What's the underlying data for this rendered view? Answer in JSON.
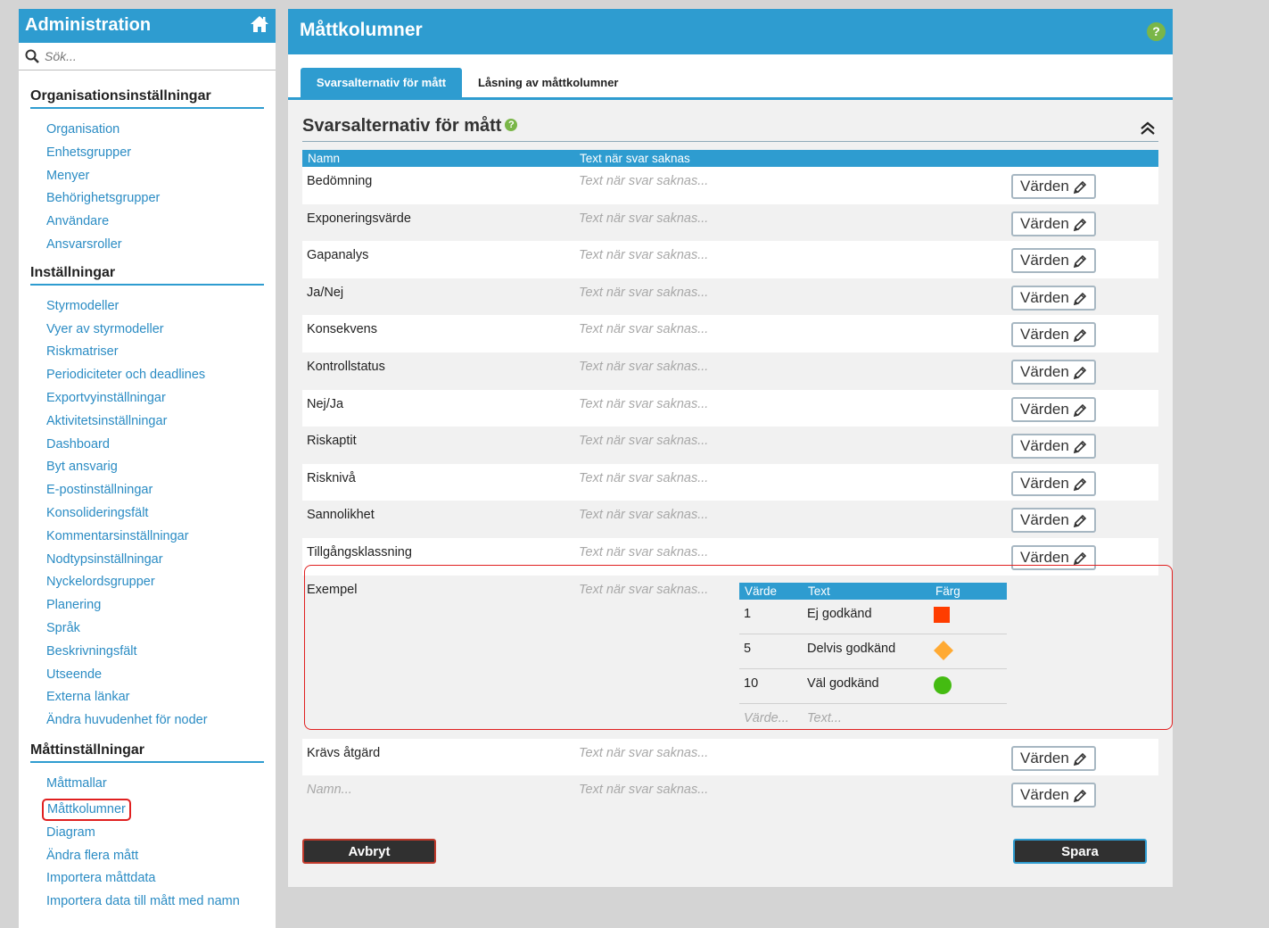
{
  "sidebar": {
    "title": "Administration",
    "search_placeholder": "Sök...",
    "sections": [
      {
        "heading": "Organisationsinställningar",
        "items": [
          "Organisation",
          "Enhetsgrupper",
          "Menyer",
          "Behörighetsgrupper",
          "Användare",
          "Ansvarsroller"
        ]
      },
      {
        "heading": "Inställningar",
        "items": [
          "Styrmodeller",
          "Vyer av styrmodeller",
          "Riskmatriser",
          "Periodiciteter och deadlines",
          "Exportvyinställningar",
          "Aktivitetsinställningar",
          "Dashboard",
          "Byt ansvarig",
          "E-postinställningar",
          "Konsolideringsfält",
          "Kommentarsinställningar",
          "Nodtypsinställningar",
          "Nyckelordsgrupper",
          "Planering",
          "Språk",
          "Beskrivningsfält",
          "Utseende",
          "Externa länkar",
          "Ändra huvudenhet för noder"
        ]
      },
      {
        "heading": "Måttinställningar",
        "items": [
          "Måttmallar",
          "Måttkolumner",
          "Diagram",
          "Ändra flera mått",
          "Importera måttdata",
          "Importera data till mått med namn"
        ]
      }
    ]
  },
  "main": {
    "title": "Måttkolumner",
    "help": "?",
    "tabs": [
      "Svarsalternativ för mått",
      "Låsning av måttkolumner"
    ],
    "section_title": "Svarsalternativ för mått",
    "columns": {
      "name": "Namn",
      "missing": "Text när svar saknas"
    },
    "missing_placeholder": "Text när svar saknas...",
    "varden_label": "Värden",
    "rows": [
      "Bedömning",
      "Exponeringsvärde",
      "Gapanalys",
      "Ja/Nej",
      "Konsekvens",
      "Kontrollstatus",
      "Nej/Ja",
      "Riskaptit",
      "Risknivå",
      "Sannolikhet",
      "Tillgångsklassning"
    ],
    "expanded": {
      "name": "Exempel",
      "columns": {
        "value": "Värde",
        "text": "Text",
        "color": "Färg"
      },
      "values": [
        {
          "value": "1",
          "text": "Ej godkänd",
          "shape": "square",
          "color": "#ff3d00"
        },
        {
          "value": "5",
          "text": "Delvis godkänd",
          "shape": "diamond",
          "color": "#ffaa33"
        },
        {
          "value": "10",
          "text": "Väl godkänd",
          "shape": "circle",
          "color": "#44bb11"
        }
      ],
      "value_placeholder": "Värde...",
      "text_placeholder": "Text..."
    },
    "after_rows": [
      "Krävs åtgärd"
    ],
    "name_placeholder": "Namn...",
    "cancel_label": "Avbryt",
    "save_label": "Spara"
  }
}
